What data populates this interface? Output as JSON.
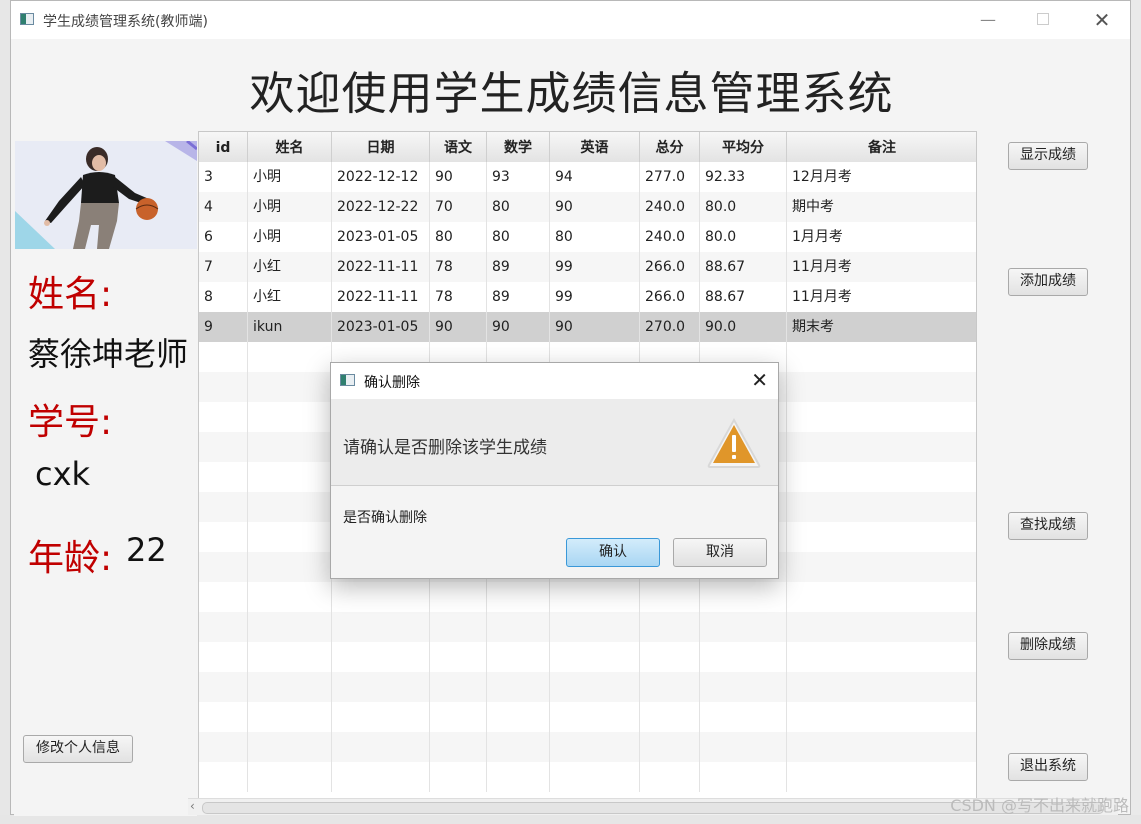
{
  "window": {
    "title": "学生成绩管理系统(教师端)",
    "minimize_icon": "minimize-icon",
    "maximize_icon": "maximize-icon",
    "close_icon": "close-icon"
  },
  "heading": "欢迎使用学生成绩信息管理系统",
  "profile": {
    "name_label": "姓名:",
    "name_value": "蔡徐坤老师",
    "id_label": "学号:",
    "id_value": "cxk",
    "age_label": "年龄:",
    "age_value": "22",
    "edit_button": "修改个人信息"
  },
  "table": {
    "columns": [
      "id",
      "姓名",
      "日期",
      "语文",
      "数学",
      "英语",
      "总分",
      "平均分",
      "备注"
    ],
    "rows": [
      [
        "3",
        "小明",
        "2022-12-12",
        "90",
        "93",
        "94",
        "277.0",
        "92.33",
        "12月月考"
      ],
      [
        "4",
        "小明",
        "2022-12-22",
        "70",
        "80",
        "90",
        "240.0",
        "80.0",
        "期中考"
      ],
      [
        "6",
        "小明",
        "2023-01-05",
        "80",
        "80",
        "80",
        "240.0",
        "80.0",
        "1月月考"
      ],
      [
        "7",
        "小红",
        "2022-11-11",
        "78",
        "89",
        "99",
        "266.0",
        "88.67",
        "11月月考"
      ],
      [
        "8",
        "小红",
        "2022-11-11",
        "78",
        "89",
        "99",
        "266.0",
        "88.67",
        "11月月考"
      ],
      [
        "9",
        "ikun",
        "2023-01-05",
        "90",
        "90",
        "90",
        "270.0",
        "90.0",
        "期末考"
      ]
    ],
    "selected_row": 5
  },
  "actions": {
    "show": "显示成绩",
    "add": "添加成绩",
    "find": "查找成绩",
    "delete": "删除成绩",
    "exit": "退出系统"
  },
  "dialog": {
    "title": "确认删除",
    "header": "请确认是否删除该学生成绩",
    "content": "是否确认删除",
    "confirm": "确认",
    "cancel": "取消",
    "icon": "warning-icon"
  },
  "watermark": "CSDN @写不出来就跑路"
}
